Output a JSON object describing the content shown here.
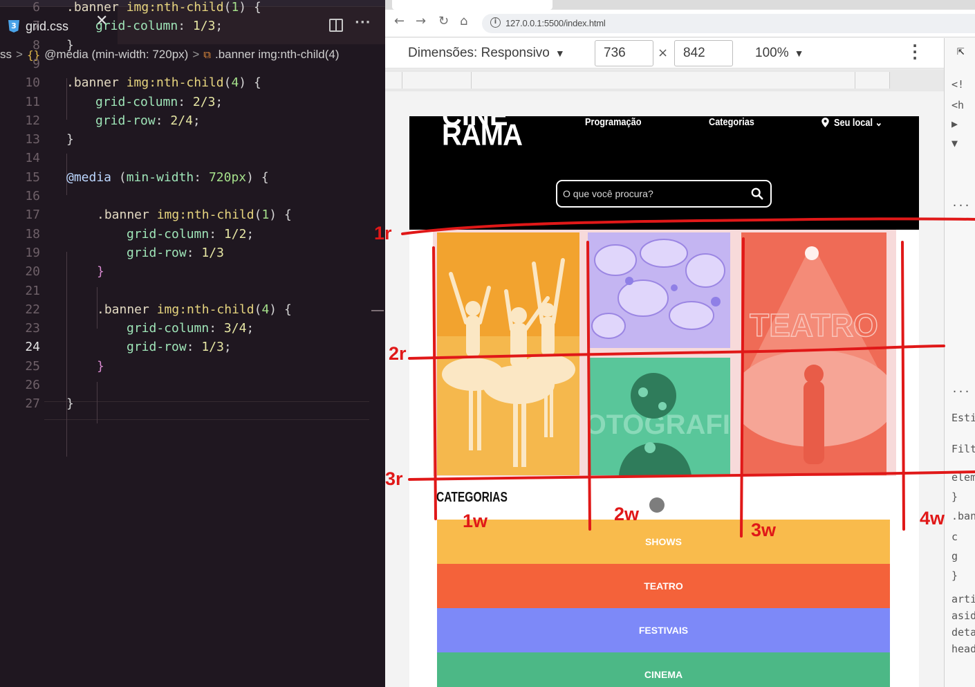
{
  "editor": {
    "tab": {
      "icon_text": "3",
      "file_name": "grid.css",
      "close_symbol": "✕"
    },
    "breadcrumb": {
      "prefix": "ss",
      "sep1": ">",
      "brace": "{}",
      "media": "@media (min-width: 720px)",
      "sep2": ">",
      "selector_icon": "⧉",
      "selector": ".banner img:nth-child(4)"
    },
    "lines": [
      {
        "n": "6",
        "code": ".banner img:nth-child(1) {"
      },
      {
        "n": "7",
        "code": "grid-column: 1/3;"
      },
      {
        "n": "8",
        "code": "}"
      },
      {
        "n": "9",
        "code": ""
      },
      {
        "n": "10",
        "code": ".banner img:nth-child(4) {"
      },
      {
        "n": "11",
        "code": "grid-column: 2/3;"
      },
      {
        "n": "12",
        "code": "grid-row: 2/4;"
      },
      {
        "n": "13",
        "code": "}"
      },
      {
        "n": "14",
        "code": ""
      },
      {
        "n": "15",
        "code": "@media (min-width: 720px) {"
      },
      {
        "n": "16",
        "code": ""
      },
      {
        "n": "17",
        "code": ".banner img:nth-child(1) {"
      },
      {
        "n": "18",
        "code": "grid-column: 1/2;"
      },
      {
        "n": "19",
        "code": "grid-row: 1/3"
      },
      {
        "n": "20",
        "code": "}"
      },
      {
        "n": "21",
        "code": ""
      },
      {
        "n": "22",
        "code": ".banner img:nth-child(4) {"
      },
      {
        "n": "23",
        "code": "grid-column: 3/4;"
      },
      {
        "n": "24",
        "code": "grid-row: 1/3;"
      },
      {
        "n": "25",
        "code": "}"
      },
      {
        "n": "26",
        "code": ""
      },
      {
        "n": "27",
        "code": "}"
      }
    ],
    "active_line": "24"
  },
  "browser": {
    "url": "127.0.0.1:5500/index.html",
    "device": {
      "label": "Dimensões: Responsivo",
      "caret": "▼",
      "width": "736",
      "times": "×",
      "height": "842",
      "zoom": "100%",
      "zoom_caret": "▼"
    },
    "icons": [
      "back-icon",
      "forward-icon",
      "reload-icon",
      "home-icon",
      "info-icon",
      "kebab-icon",
      "inspect-icon"
    ]
  },
  "site": {
    "logo_top": "CINE",
    "logo": "RAMA",
    "nav": [
      "Programação",
      "Categorias",
      "Seu local"
    ],
    "nav_caret": "⌄",
    "search_placeholder": "O que você procura?",
    "categories_title": "CATEGORIAS",
    "categories": [
      {
        "label": "SHOWS",
        "color": "#f9bb4c"
      },
      {
        "label": "TEATRO",
        "color": "#f4623a"
      },
      {
        "label": "FESTIVAIS",
        "color": "#7d89f8"
      },
      {
        "label": "CINEMA",
        "color": "#4cb886"
      }
    ],
    "banner_texts": [
      "TEATRO",
      "FOTOGRAFIA"
    ],
    "tile_colors": {
      "dance": "#f2a32f",
      "art": "#c4b5f2",
      "theatre": "#ef6b56",
      "photo": "#59c69a"
    }
  },
  "devtools": {
    "lines": [
      "<!",
      "<h",
      "▶",
      "▼",
      "···",
      "···",
      "Esti",
      "Filtr",
      "elem",
      "}",
      ".ban",
      "c",
      "g",
      "}",
      "arti",
      "asid",
      "deta",
      "head"
    ]
  },
  "annotations": {
    "rows": [
      "1r",
      "2r",
      "3r"
    ],
    "cols": [
      "1w",
      "2w",
      "3w",
      "4w"
    ],
    "color": "#e01818"
  }
}
